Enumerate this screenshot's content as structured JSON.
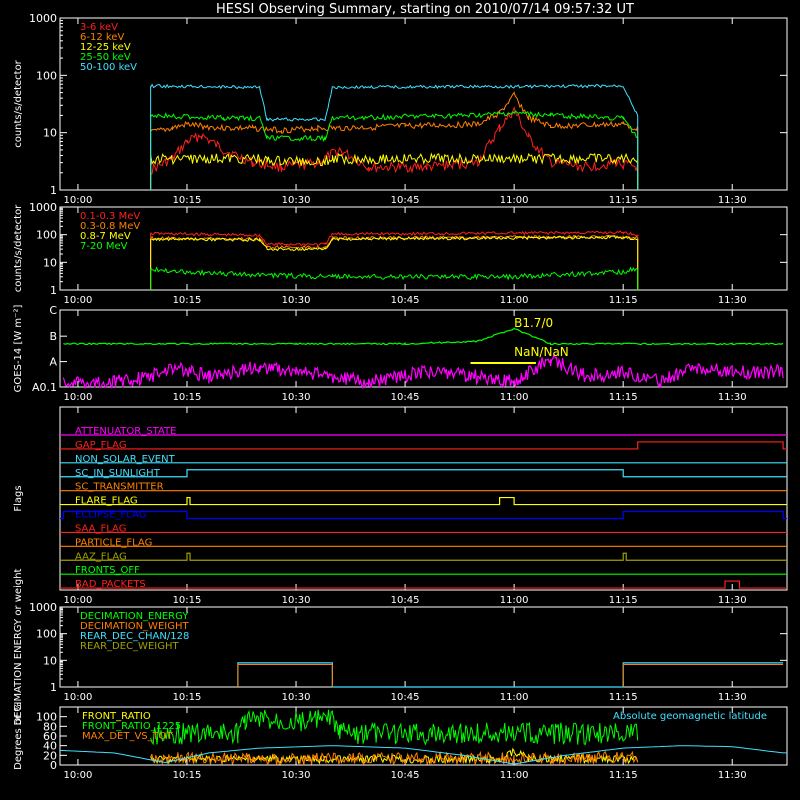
{
  "title": "HESSI Observing Summary, starting on 2010/07/14 09:57:32 UT",
  "time_axis": {
    "start": "2010-07-14T09:57:32",
    "end": "2010-07-14T11:37:32",
    "tick_labels": [
      "10:00",
      "10:15",
      "10:30",
      "10:45",
      "11:00",
      "11:15",
      "11:30"
    ],
    "tick_times": [
      "10:00",
      "10:15",
      "10:30",
      "10:45",
      "11:00",
      "11:15",
      "11:30"
    ]
  },
  "colors": {
    "background": "#000000",
    "axes": "#ffffff",
    "red": "#ff2020",
    "orange": "#ff8000",
    "yellow": "#ffff00",
    "green": "#00ff00",
    "cyan": "#40e0ff",
    "magenta": "#ff00ff",
    "blue": "#0000ff",
    "olive": "#a0a000"
  },
  "chart_data": [
    {
      "id": "xray",
      "type": "line",
      "ylabel": "counts/s/detector",
      "yscale": "log",
      "ylim": [
        1,
        1000
      ],
      "y_ticks": [
        "1",
        "10",
        "100",
        "1000"
      ],
      "series": [
        {
          "name": "3-6 keV",
          "color": "#ff2020",
          "x": [
            "10:10",
            "10:13",
            "10:15",
            "10:17",
            "10:20",
            "10:24",
            "10:28",
            "10:33",
            "10:36",
            "10:40",
            "10:48",
            "10:55",
            "10:58",
            "11:00",
            "11:02",
            "11:05",
            "11:10",
            "11:14",
            "11:17"
          ],
          "values": [
            2.2,
            3.5,
            7,
            9,
            5,
            3,
            2.5,
            3,
            5,
            2.5,
            2.5,
            3,
            12,
            25,
            8,
            3,
            2.5,
            3,
            2.5
          ]
        },
        {
          "name": "6-12 keV",
          "color": "#ff8000",
          "x": [
            "10:10",
            "10:13",
            "10:15",
            "10:17",
            "10:20",
            "10:24",
            "10:28",
            "10:33",
            "10:36",
            "10:45",
            "10:55",
            "10:58",
            "11:00",
            "11:02",
            "11:05",
            "11:15",
            "11:17"
          ],
          "values": [
            10,
            12,
            14,
            13,
            12,
            12,
            11,
            12,
            12,
            13,
            14,
            22,
            45,
            18,
            13,
            14,
            12
          ]
        },
        {
          "name": "12-25 keV",
          "color": "#ffff00",
          "x": [
            "10:10",
            "10:25",
            "10:26",
            "10:34",
            "10:35",
            "11:15",
            "11:17"
          ],
          "values": [
            3.5,
            3.5,
            3.2,
            3.2,
            3.5,
            3.5,
            3.5
          ]
        },
        {
          "name": "25-50 keV",
          "color": "#00ff00",
          "x": [
            "10:10",
            "10:20",
            "10:25",
            "10:26",
            "10:34",
            "10:35",
            "10:55",
            "11:00",
            "11:05",
            "11:15",
            "11:17"
          ],
          "values": [
            20,
            18,
            18,
            8,
            8,
            18,
            20,
            22,
            20,
            18,
            8
          ]
        },
        {
          "name": "50-100 keV",
          "color": "#40e0ff",
          "x": [
            "10:10",
            "10:25",
            "10:26",
            "10:34",
            "10:35",
            "11:15",
            "11:17"
          ],
          "values": [
            65,
            62,
            17,
            17,
            62,
            65,
            20
          ]
        }
      ],
      "segment_end": "11:17"
    },
    {
      "id": "gamma",
      "type": "line",
      "ylabel": "counts/s/detector",
      "yscale": "log",
      "ylim": [
        1,
        1000
      ],
      "y_ticks": [
        "1",
        "10",
        "100",
        "1000"
      ],
      "series": [
        {
          "name": "0.1-0.3 MeV",
          "color": "#ff2020",
          "x": [
            "10:10",
            "10:25",
            "10:26",
            "10:34",
            "10:35",
            "11:15",
            "11:17"
          ],
          "values": [
            110,
            95,
            45,
            45,
            105,
            120,
            100
          ]
        },
        {
          "name": "0.3-0.8 MeV",
          "color": "#ff8000",
          "x": [
            "10:10",
            "10:25",
            "10:26",
            "10:34",
            "10:35",
            "11:15",
            "11:17"
          ],
          "values": [
            75,
            70,
            35,
            35,
            75,
            85,
            75
          ]
        },
        {
          "name": "0.8-7 MeV",
          "color": "#ffff00",
          "x": [
            "10:10",
            "10:25",
            "10:26",
            "10:34",
            "10:35",
            "11:15",
            "11:17"
          ],
          "values": [
            70,
            65,
            30,
            30,
            70,
            80,
            70
          ]
        },
        {
          "name": "7-20 MeV",
          "color": "#00ff00",
          "x": [
            "10:10",
            "10:15",
            "10:25",
            "10:35",
            "11:00",
            "11:15",
            "11:17"
          ],
          "values": [
            6,
            4.5,
            3.5,
            3,
            3,
            4.5,
            6
          ]
        }
      ],
      "segment_end": "11:17"
    },
    {
      "id": "goes",
      "type": "line",
      "ylabel": "GOES-14 [W m⁻²]",
      "y_ticks": [
        "A0.1",
        "A",
        "B",
        "C"
      ],
      "annotations": [
        "B1.7/0",
        "NaN/NaN"
      ],
      "series": [
        {
          "name": "GOES long",
          "color": "#00ff00",
          "x": [
            "09:58",
            "10:15",
            "10:30",
            "10:45",
            "10:55",
            "11:00",
            "11:05",
            "11:15",
            "11:30",
            "11:37"
          ],
          "values": [
            0.85,
            0.85,
            0.85,
            0.85,
            0.9,
            1.15,
            0.85,
            0.85,
            0.85,
            0.85
          ]
        },
        {
          "name": "GOES short",
          "color": "#ff00ff",
          "x": [
            "09:58",
            "10:05",
            "10:10",
            "10:13",
            "10:18",
            "10:25",
            "10:30",
            "10:40",
            "10:48",
            "10:55",
            "11:00",
            "11:05",
            "11:10",
            "11:15",
            "11:20",
            "11:25",
            "11:30",
            "11:37"
          ],
          "values": [
            0.1,
            0.1,
            0.2,
            0.4,
            0.2,
            0.4,
            0.3,
            0.1,
            0.3,
            0.2,
            0.1,
            0.55,
            0.2,
            0.3,
            0.1,
            0.4,
            0.3,
            0.3
          ]
        }
      ]
    },
    {
      "id": "flags",
      "type": "line",
      "ylabel": "Flags",
      "flags": [
        {
          "name": "ATTENUATOR_STATE",
          "color": "#ff00ff",
          "changes": []
        },
        {
          "name": "GAP_FLAG",
          "color": "#ff2020",
          "changes": [
            [
              "11:17",
              "11:37"
            ]
          ]
        },
        {
          "name": "NON_SOLAR_EVENT",
          "color": "#40e0ff",
          "changes": []
        },
        {
          "name": "SC_IN_SUNLIGHT",
          "color": "#40e0ff",
          "changes": [
            [
              "10:15",
              "11:15"
            ]
          ]
        },
        {
          "name": "SC_TRANSMITTER",
          "color": "#ff8000",
          "changes": []
        },
        {
          "name": "FLARE_FLAG",
          "color": "#ffff00",
          "changes": [
            [
              "10:15",
              "10:15"
            ],
            [
              "10:58",
              "11:00"
            ]
          ]
        },
        {
          "name": "ECLIPSE_FLAG",
          "color": "#0000ff",
          "changes": [
            [
              "09:58",
              "10:15"
            ],
            [
              "11:15",
              "11:37"
            ]
          ]
        },
        {
          "name": "SAA_FLAG",
          "color": "#ff2020",
          "changes": []
        },
        {
          "name": "PARTICLE_FLAG",
          "color": "#ff8000",
          "changes": []
        },
        {
          "name": "AAZ_FLAG",
          "color": "#a0a000",
          "changes": [
            [
              "10:15",
              "10:15"
            ],
            [
              "11:15",
              "11:15"
            ]
          ]
        },
        {
          "name": "FRONTS_OFF",
          "color": "#00ff00",
          "changes": []
        },
        {
          "name": "BAD_PACKETS",
          "color": "#ff2020",
          "changes": [
            [
              "11:29",
              "11:31"
            ]
          ]
        }
      ]
    },
    {
      "id": "decimation",
      "type": "line",
      "ylabel": "DECIMATION ENERGY or weight",
      "yscale": "log",
      "ylim": [
        1,
        1000
      ],
      "y_ticks": [
        "1",
        "10",
        "100",
        "1000"
      ],
      "series": [
        {
          "name": "DECIMATION_ENERGY",
          "color": "#00ff00"
        },
        {
          "name": "DECIMATION_WEIGHT",
          "color": "#ff8000"
        },
        {
          "name": "REAR_DEC_CHAN/128",
          "color": "#40e0ff",
          "x": [
            "10:22",
            "10:22",
            "10:35",
            "10:35",
            "11:15",
            "11:15",
            "11:37"
          ],
          "values": [
            1,
            8,
            8,
            1,
            1,
            8,
            8
          ]
        },
        {
          "name": "REAR_DEC_WEIGHT",
          "color": "#a0a000"
        }
      ]
    },
    {
      "id": "ratio",
      "type": "line",
      "ylabel": "Degrees or %",
      "ylim": [
        0,
        120
      ],
      "y_ticks": [
        "0",
        "20",
        "40",
        "60",
        "80",
        "100"
      ],
      "extra_label": "Absolute geomagnetic latitude",
      "series": [
        {
          "name": "FRONT_RATIO",
          "color": "#ffff00",
          "x": [
            "10:10",
            "10:25",
            "10:30",
            "10:58",
            "11:00",
            "11:02",
            "11:15",
            "11:17"
          ],
          "values": [
            12,
            13,
            12,
            12,
            28,
            14,
            12,
            12
          ]
        },
        {
          "name": "FRONT_RATIO_1225",
          "color": "#00ff00",
          "x": [
            "10:10",
            "10:22",
            "10:23",
            "10:35",
            "10:36",
            "11:15",
            "11:17"
          ],
          "values": [
            65,
            65,
            92,
            92,
            65,
            65,
            65
          ]
        },
        {
          "name": "MAX_DET_VS_TOT",
          "color": "#ff8000",
          "x": [
            "10:10",
            "10:30",
            "11:00",
            "11:17"
          ],
          "values": [
            15,
            12,
            14,
            16
          ]
        },
        {
          "name": "Absolute geomagnetic latitude",
          "color": "#40e0ff",
          "x": [
            "09:58",
            "10:05",
            "10:12",
            "10:18",
            "10:25",
            "10:35",
            "10:45",
            "10:53",
            "11:00",
            "11:07",
            "11:15",
            "11:23",
            "11:30",
            "11:37"
          ],
          "values": [
            30,
            25,
            5,
            25,
            35,
            40,
            35,
            20,
            2,
            20,
            35,
            40,
            38,
            25
          ]
        }
      ]
    }
  ]
}
